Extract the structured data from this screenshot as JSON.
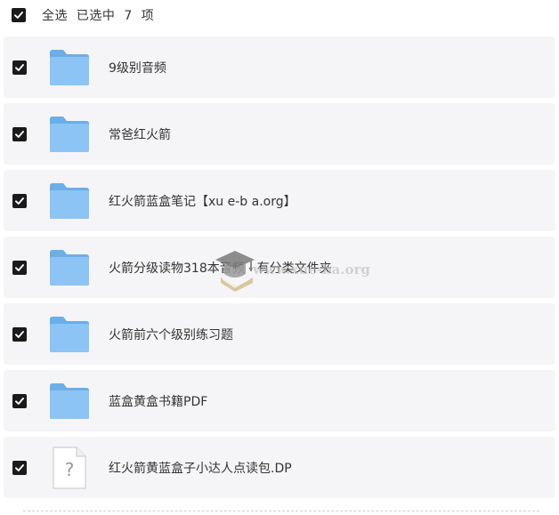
{
  "header": {
    "select_all_label": "全选",
    "selected_text": "已选中",
    "selected_count": "7",
    "unit": "项"
  },
  "items": [
    {
      "name": "9级别音频",
      "type": "folder",
      "checked": true
    },
    {
      "name": "常爸红火箭",
      "type": "folder",
      "checked": true
    },
    {
      "name": "红火箭蓝盒笔记【xu e-b a.org】",
      "type": "folder",
      "checked": true
    },
    {
      "name": "火箭分级读物318本音频 - 有分类文件夹",
      "type": "folder",
      "checked": true
    },
    {
      "name": "火箭前六个级别练习题",
      "type": "folder",
      "checked": true
    },
    {
      "name": "蓝盒黄盒书籍PDF",
      "type": "folder",
      "checked": true
    },
    {
      "name": "红火箭黄蓝盒子小达人点读包.DP",
      "type": "unknown-file",
      "checked": true
    }
  ],
  "watermark": {
    "text": "www.xue-ba.org"
  },
  "colors": {
    "row_bg": "#f5f5f7",
    "folder_blue": "#8cc4f5",
    "checkbox": "#1a1a1a",
    "text": "#333333"
  }
}
